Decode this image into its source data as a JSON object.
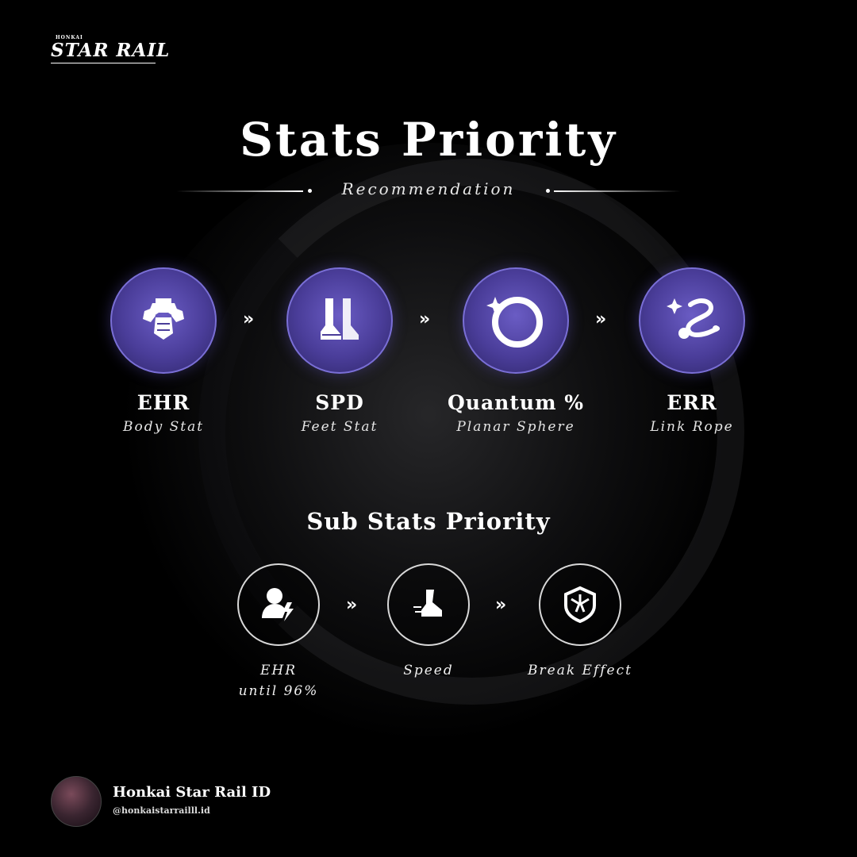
{
  "logo": {
    "small": "HONKAI",
    "text": "STAR RAIL"
  },
  "header": {
    "title": "Stats Priority",
    "subtitle": "Recommendation"
  },
  "main_stats": [
    {
      "name": "EHR",
      "slot": "Body Stat",
      "icon": "body-armor-icon"
    },
    {
      "name": "SPD",
      "slot": "Feet Stat",
      "icon": "boots-icon"
    },
    {
      "name": "Quantum %",
      "slot": "Planar Sphere",
      "icon": "sphere-icon"
    },
    {
      "name": "ERR",
      "slot": "Link Rope",
      "icon": "link-rope-icon"
    }
  ],
  "arrow_symbol": "»",
  "sub_stats": {
    "title": "Sub Stats Priority",
    "items": [
      {
        "label": "EHR",
        "label2": "until 96%",
        "icon": "effect-hit-rate-icon"
      },
      {
        "label": "Speed",
        "label2": "",
        "icon": "speed-boot-icon"
      },
      {
        "label": "Break Effect",
        "label2": "",
        "icon": "break-effect-icon"
      }
    ]
  },
  "footer": {
    "name": "Honkai Star Rail ID",
    "handle": "@honkaistarrailll.id"
  },
  "colors": {
    "accent_purple": "#4a3d99",
    "ring_purple": "#7a6fd6",
    "background": "#000000"
  }
}
